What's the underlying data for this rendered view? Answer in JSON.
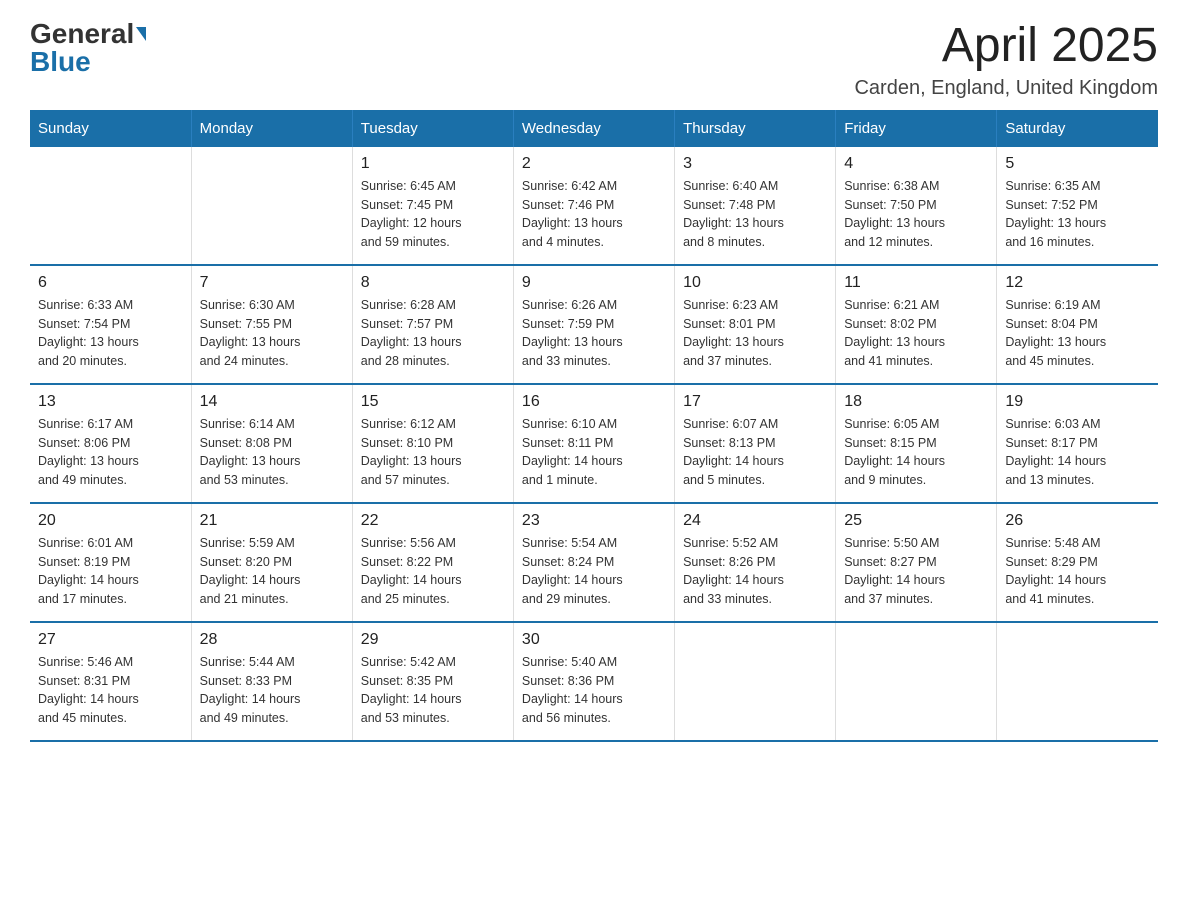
{
  "logo": {
    "general": "General",
    "blue": "Blue"
  },
  "title": "April 2025",
  "location": "Carden, England, United Kingdom",
  "days_of_week": [
    "Sunday",
    "Monday",
    "Tuesday",
    "Wednesday",
    "Thursday",
    "Friday",
    "Saturday"
  ],
  "weeks": [
    [
      {
        "day": "",
        "info": ""
      },
      {
        "day": "",
        "info": ""
      },
      {
        "day": "1",
        "info": "Sunrise: 6:45 AM\nSunset: 7:45 PM\nDaylight: 12 hours\nand 59 minutes."
      },
      {
        "day": "2",
        "info": "Sunrise: 6:42 AM\nSunset: 7:46 PM\nDaylight: 13 hours\nand 4 minutes."
      },
      {
        "day": "3",
        "info": "Sunrise: 6:40 AM\nSunset: 7:48 PM\nDaylight: 13 hours\nand 8 minutes."
      },
      {
        "day": "4",
        "info": "Sunrise: 6:38 AM\nSunset: 7:50 PM\nDaylight: 13 hours\nand 12 minutes."
      },
      {
        "day": "5",
        "info": "Sunrise: 6:35 AM\nSunset: 7:52 PM\nDaylight: 13 hours\nand 16 minutes."
      }
    ],
    [
      {
        "day": "6",
        "info": "Sunrise: 6:33 AM\nSunset: 7:54 PM\nDaylight: 13 hours\nand 20 minutes."
      },
      {
        "day": "7",
        "info": "Sunrise: 6:30 AM\nSunset: 7:55 PM\nDaylight: 13 hours\nand 24 minutes."
      },
      {
        "day": "8",
        "info": "Sunrise: 6:28 AM\nSunset: 7:57 PM\nDaylight: 13 hours\nand 28 minutes."
      },
      {
        "day": "9",
        "info": "Sunrise: 6:26 AM\nSunset: 7:59 PM\nDaylight: 13 hours\nand 33 minutes."
      },
      {
        "day": "10",
        "info": "Sunrise: 6:23 AM\nSunset: 8:01 PM\nDaylight: 13 hours\nand 37 minutes."
      },
      {
        "day": "11",
        "info": "Sunrise: 6:21 AM\nSunset: 8:02 PM\nDaylight: 13 hours\nand 41 minutes."
      },
      {
        "day": "12",
        "info": "Sunrise: 6:19 AM\nSunset: 8:04 PM\nDaylight: 13 hours\nand 45 minutes."
      }
    ],
    [
      {
        "day": "13",
        "info": "Sunrise: 6:17 AM\nSunset: 8:06 PM\nDaylight: 13 hours\nand 49 minutes."
      },
      {
        "day": "14",
        "info": "Sunrise: 6:14 AM\nSunset: 8:08 PM\nDaylight: 13 hours\nand 53 minutes."
      },
      {
        "day": "15",
        "info": "Sunrise: 6:12 AM\nSunset: 8:10 PM\nDaylight: 13 hours\nand 57 minutes."
      },
      {
        "day": "16",
        "info": "Sunrise: 6:10 AM\nSunset: 8:11 PM\nDaylight: 14 hours\nand 1 minute."
      },
      {
        "day": "17",
        "info": "Sunrise: 6:07 AM\nSunset: 8:13 PM\nDaylight: 14 hours\nand 5 minutes."
      },
      {
        "day": "18",
        "info": "Sunrise: 6:05 AM\nSunset: 8:15 PM\nDaylight: 14 hours\nand 9 minutes."
      },
      {
        "day": "19",
        "info": "Sunrise: 6:03 AM\nSunset: 8:17 PM\nDaylight: 14 hours\nand 13 minutes."
      }
    ],
    [
      {
        "day": "20",
        "info": "Sunrise: 6:01 AM\nSunset: 8:19 PM\nDaylight: 14 hours\nand 17 minutes."
      },
      {
        "day": "21",
        "info": "Sunrise: 5:59 AM\nSunset: 8:20 PM\nDaylight: 14 hours\nand 21 minutes."
      },
      {
        "day": "22",
        "info": "Sunrise: 5:56 AM\nSunset: 8:22 PM\nDaylight: 14 hours\nand 25 minutes."
      },
      {
        "day": "23",
        "info": "Sunrise: 5:54 AM\nSunset: 8:24 PM\nDaylight: 14 hours\nand 29 minutes."
      },
      {
        "day": "24",
        "info": "Sunrise: 5:52 AM\nSunset: 8:26 PM\nDaylight: 14 hours\nand 33 minutes."
      },
      {
        "day": "25",
        "info": "Sunrise: 5:50 AM\nSunset: 8:27 PM\nDaylight: 14 hours\nand 37 minutes."
      },
      {
        "day": "26",
        "info": "Sunrise: 5:48 AM\nSunset: 8:29 PM\nDaylight: 14 hours\nand 41 minutes."
      }
    ],
    [
      {
        "day": "27",
        "info": "Sunrise: 5:46 AM\nSunset: 8:31 PM\nDaylight: 14 hours\nand 45 minutes."
      },
      {
        "day": "28",
        "info": "Sunrise: 5:44 AM\nSunset: 8:33 PM\nDaylight: 14 hours\nand 49 minutes."
      },
      {
        "day": "29",
        "info": "Sunrise: 5:42 AM\nSunset: 8:35 PM\nDaylight: 14 hours\nand 53 minutes."
      },
      {
        "day": "30",
        "info": "Sunrise: 5:40 AM\nSunset: 8:36 PM\nDaylight: 14 hours\nand 56 minutes."
      },
      {
        "day": "",
        "info": ""
      },
      {
        "day": "",
        "info": ""
      },
      {
        "day": "",
        "info": ""
      }
    ]
  ]
}
